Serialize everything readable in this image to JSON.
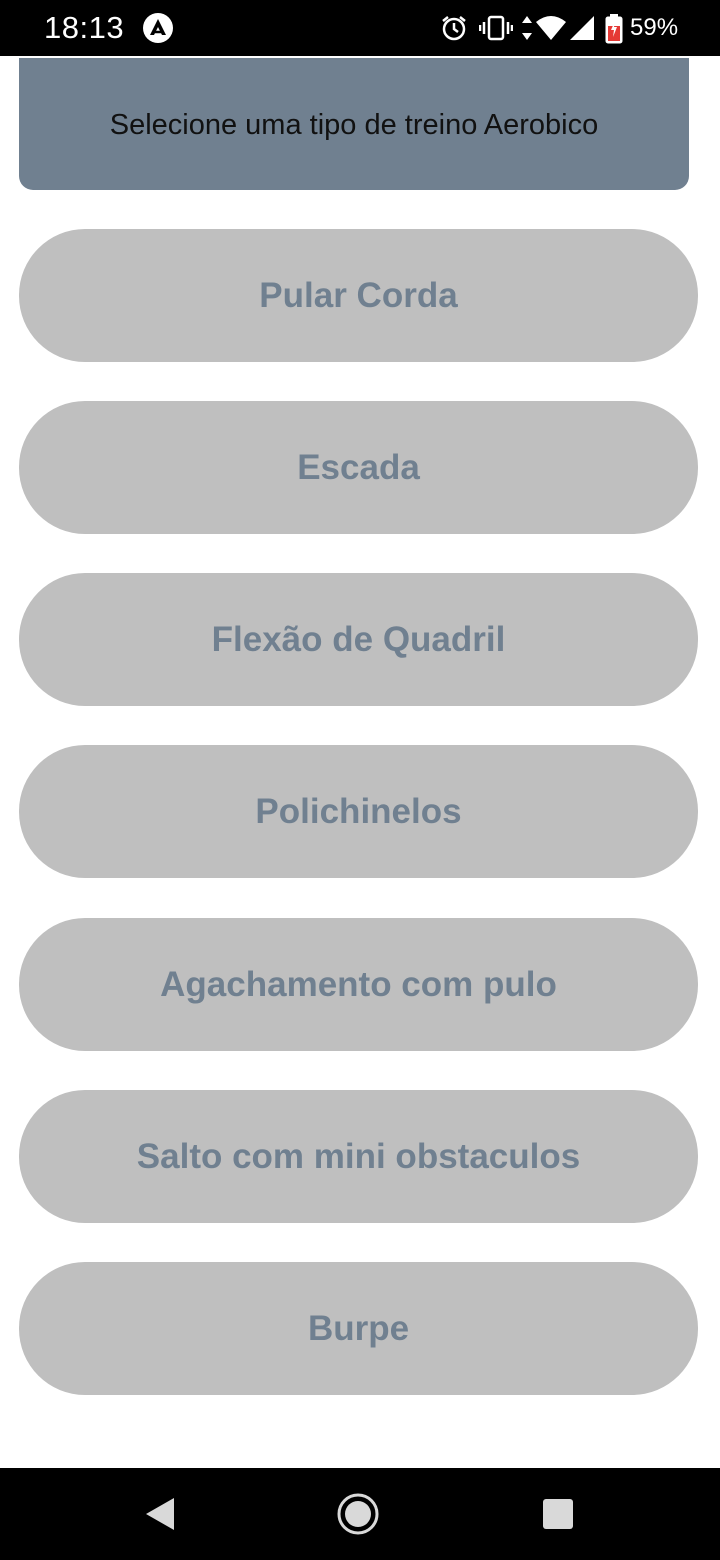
{
  "status_bar": {
    "time": "18:13",
    "battery_percent": "59%",
    "icons": [
      "app-notification-icon",
      "alarm-icon",
      "vibrate-icon",
      "data-arrows-icon",
      "wifi-icon",
      "cell-signal-icon",
      "battery-icon"
    ]
  },
  "header": {
    "text": "Selecione uma tipo de treino Aerobico",
    "background_color": "#708090"
  },
  "options": [
    {
      "label": "Pular Corda"
    },
    {
      "label": "Escada"
    },
    {
      "label": "Flexão de Quadril"
    },
    {
      "label": "Polichinelos"
    },
    {
      "label": "Agachamento com pulo"
    },
    {
      "label": "Salto com mini obstaculos"
    },
    {
      "label": "Burpe"
    }
  ],
  "colors": {
    "button_bg": "#bfbfbf",
    "button_text": "#708090"
  },
  "nav_bar": {
    "buttons": [
      "back-icon",
      "home-icon",
      "recents-icon"
    ]
  }
}
